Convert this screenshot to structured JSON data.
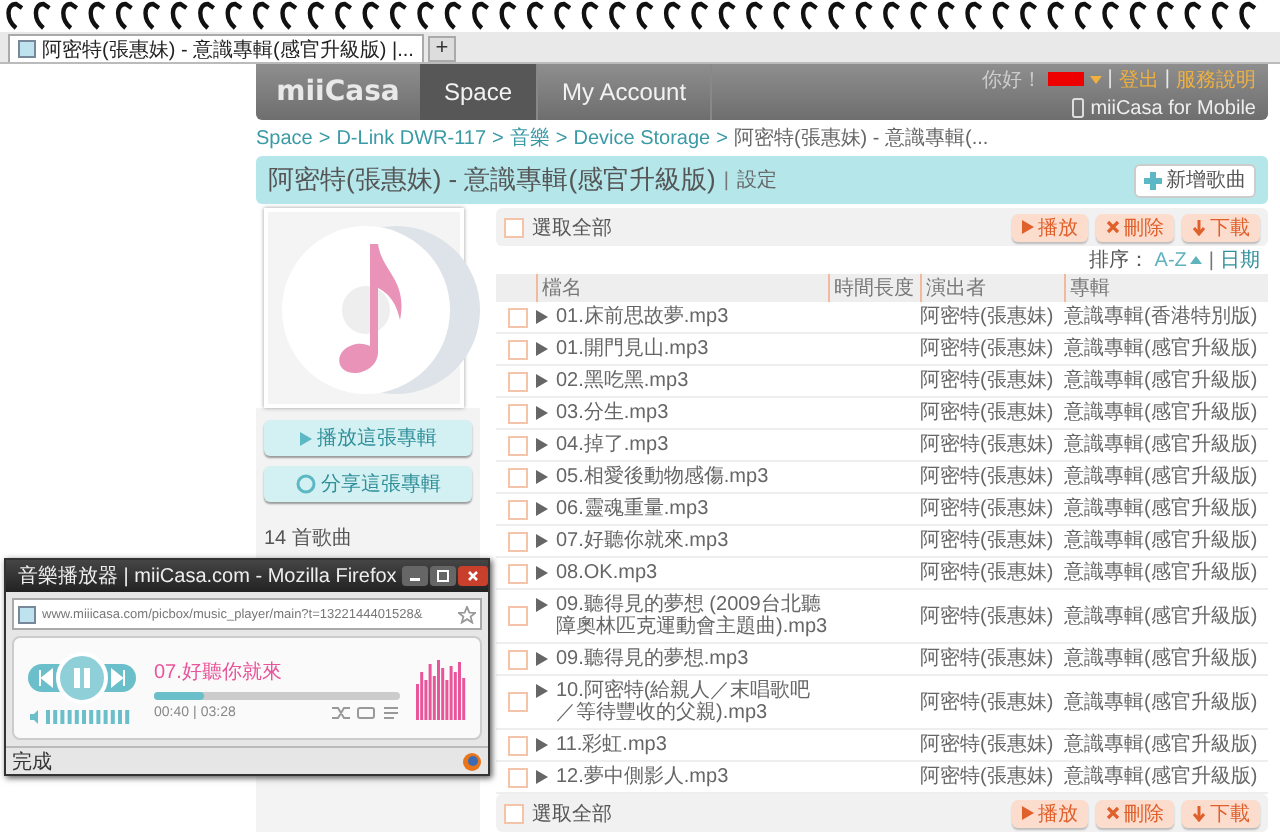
{
  "browser_tab": {
    "title": "阿密特(張惠妹) - 意識專輯(感官升級版) |...",
    "new_tab": "+"
  },
  "header": {
    "logo": "miiCasa",
    "tabs": [
      {
        "label": "Space",
        "selected": true
      },
      {
        "label": "My Account",
        "selected": false
      }
    ],
    "greeting": "你好！",
    "links": [
      {
        "separator": "|",
        "label": "登出"
      },
      {
        "separator": "|",
        "label": "服務說明"
      }
    ],
    "mobile": "miiCasa for Mobile"
  },
  "breadcrumb": [
    {
      "label": "Space"
    },
    {
      "separator": ">",
      "label": "D-Link DWR-117"
    },
    {
      "separator": ">",
      "label": "音樂"
    },
    {
      "separator": ">",
      "label": "Device Storage"
    },
    {
      "separator": ">",
      "label": "阿密特(張惠妹) - 意識專輯(..."
    }
  ],
  "title": {
    "text": "阿密特(張惠妹) - 意識專輯(感官升級版)",
    "separator": "|",
    "link": "設定",
    "add_button": "新增歌曲"
  },
  "album": {
    "play_button": "播放這張專輯",
    "share_button": "分享這張專輯",
    "count": "14 首歌曲"
  },
  "toolbar": {
    "select_all": "選取全部",
    "checked": false,
    "buttons": [
      {
        "kind": "play",
        "label": "播放"
      },
      {
        "kind": "delete",
        "label": "刪除"
      },
      {
        "kind": "download",
        "label": "下載"
      }
    ]
  },
  "sort": {
    "label": "排序：",
    "options": [
      {
        "label": "A-Z",
        "selected": true,
        "separator": "|"
      },
      {
        "label": "日期",
        "selected": false
      }
    ]
  },
  "table": {
    "columns": [
      "檔名",
      "時間長度",
      "演出者",
      "專輯"
    ],
    "rows": [
      {
        "name": "01.床前思故夢.mp3",
        "artist": "阿密特(張惠妹)",
        "album": "意識專輯(香港特別版)",
        "checked": false
      },
      {
        "name": "01.開門見山.mp3",
        "artist": "阿密特(張惠妹)",
        "album": "意識專輯(感官升級版)",
        "checked": false
      },
      {
        "name": "02.黑吃黑.mp3",
        "artist": "阿密特(張惠妹)",
        "album": "意識專輯(感官升級版)",
        "checked": false
      },
      {
        "name": "03.分生.mp3",
        "artist": "阿密特(張惠妹)",
        "album": "意識專輯(感官升級版)",
        "checked": false
      },
      {
        "name": "04.掉了.mp3",
        "artist": "阿密特(張惠妹)",
        "album": "意識專輯(感官升級版)",
        "checked": false
      },
      {
        "name": "05.相愛後動物感傷.mp3",
        "artist": "阿密特(張惠妹)",
        "album": "意識專輯(感官升級版)",
        "checked": false
      },
      {
        "name": "06.靈魂重量.mp3",
        "artist": "阿密特(張惠妹)",
        "album": "意識專輯(感官升級版)",
        "checked": false
      },
      {
        "name": "07.好聽你就來.mp3",
        "artist": "阿密特(張惠妹)",
        "album": "意識專輯(感官升級版)",
        "checked": false
      },
      {
        "name": "08.OK.mp3",
        "artist": "阿密特(張惠妹)",
        "album": "意識專輯(感官升級版)",
        "checked": false
      },
      {
        "name": "09.聽得見的夢想 (2009台北聽障奧林匹克運動會主題曲).mp3",
        "artist": "阿密特(張惠妹)",
        "album": "意識專輯(感官升級版)",
        "checked": false
      },
      {
        "name": "09.聽得見的夢想.mp3",
        "artist": "阿密特(張惠妹)",
        "album": "意識專輯(感官升級版)",
        "checked": false
      },
      {
        "name": "10.阿密特(給親人／末唱歌吧／等待豐收的父親).mp3",
        "artist": "阿密特(張惠妹)",
        "album": "意識專輯(感官升級版)",
        "checked": false
      },
      {
        "name": "11.彩虹.mp3",
        "artist": "阿密特(張惠妹)",
        "album": "意識專輯(感官升級版)",
        "checked": false
      },
      {
        "name": "12.夢中側影人.mp3",
        "artist": "阿密特(張惠妹)",
        "album": "意識專輯(感官升級版)",
        "checked": false
      }
    ]
  },
  "footer": {
    "select_all": "選取全部",
    "checked": false,
    "buttons": [
      {
        "kind": "play",
        "label": "播放"
      },
      {
        "kind": "delete",
        "label": "刪除"
      },
      {
        "kind": "download",
        "label": "下載"
      }
    ]
  },
  "player": {
    "title": "音樂播放器 | miiCasa.com - Mozilla Firefox",
    "url": "www.miiicasa.com/picbox/music_player/main?t=1322144401528&",
    "playing": true,
    "song": "07.好聽你就來",
    "level": 0.2,
    "elapsed": "00:40",
    "separator": "|",
    "total": "03:28",
    "status": "完成"
  }
}
